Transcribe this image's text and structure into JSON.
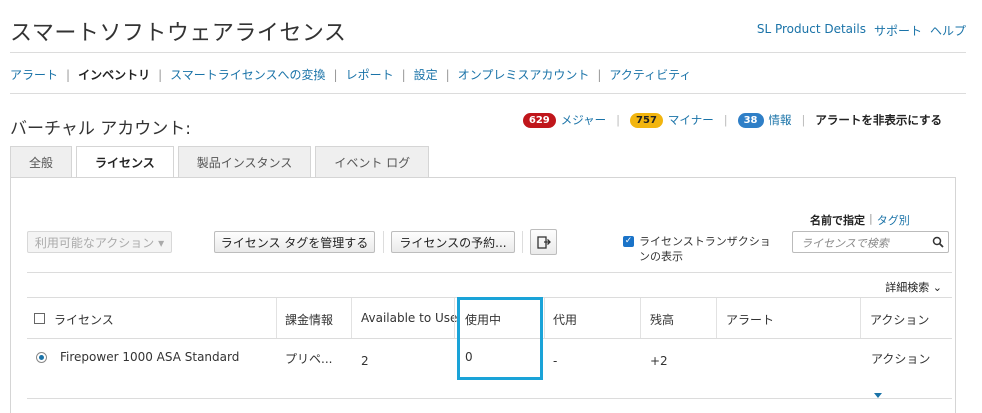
{
  "header": {
    "title": "スマートソフトウェアライセンス",
    "links": [
      "SL Product Details",
      "サポート",
      "ヘルプ"
    ]
  },
  "nav": {
    "items": [
      "アラート",
      "インベントリ",
      "スマートライセンスへの変換",
      "レポート",
      "設定",
      "オンプレミスアカウント",
      "アクティビティ"
    ],
    "active": "インベントリ"
  },
  "account": {
    "label": "バーチャル アカウント:"
  },
  "alerts": {
    "major_count": "629",
    "major_label": "メジャー",
    "minor_count": "757",
    "minor_label": "マイナー",
    "info_count": "38",
    "info_label": "情報",
    "hide_label": "アラートを非表示にする"
  },
  "tabs": [
    "全般",
    "ライセンス",
    "製品インスタンス",
    "イベント ログ"
  ],
  "toolbar": {
    "actions_label": "利用可能なアクション ▾",
    "manage_tags_label": "ライセンス タグを管理する",
    "reserve_label": "ライセンスの予約...",
    "show_transactions_line1": "ライセンストランザクショ",
    "show_transactions_line2": "ンの表示",
    "filter_by_name": "名前で指定",
    "filter_separator": "|",
    "filter_by_tag": "タグ別",
    "search_placeholder": "ライセンスで検索",
    "advanced_search": "詳細検索 ⌄"
  },
  "table": {
    "columns": [
      "ライセンス",
      "課金情報",
      "Available to Use",
      "使用中",
      "代用",
      "残高",
      "アラート",
      "アクション"
    ],
    "rows": [
      {
        "license": "Firepower 1000 ASA Standard",
        "billing": "プリペ...",
        "available": "2",
        "in_use": "0",
        "substitution": "-",
        "balance": "+2",
        "alert": "",
        "action": "アクション"
      }
    ]
  },
  "colors": {
    "link": "#1a73a8",
    "major_badge": "#c0161b",
    "minor_badge": "#f2b50f",
    "info_badge": "#2f7fc7",
    "highlight_box": "#1aa3d8"
  }
}
